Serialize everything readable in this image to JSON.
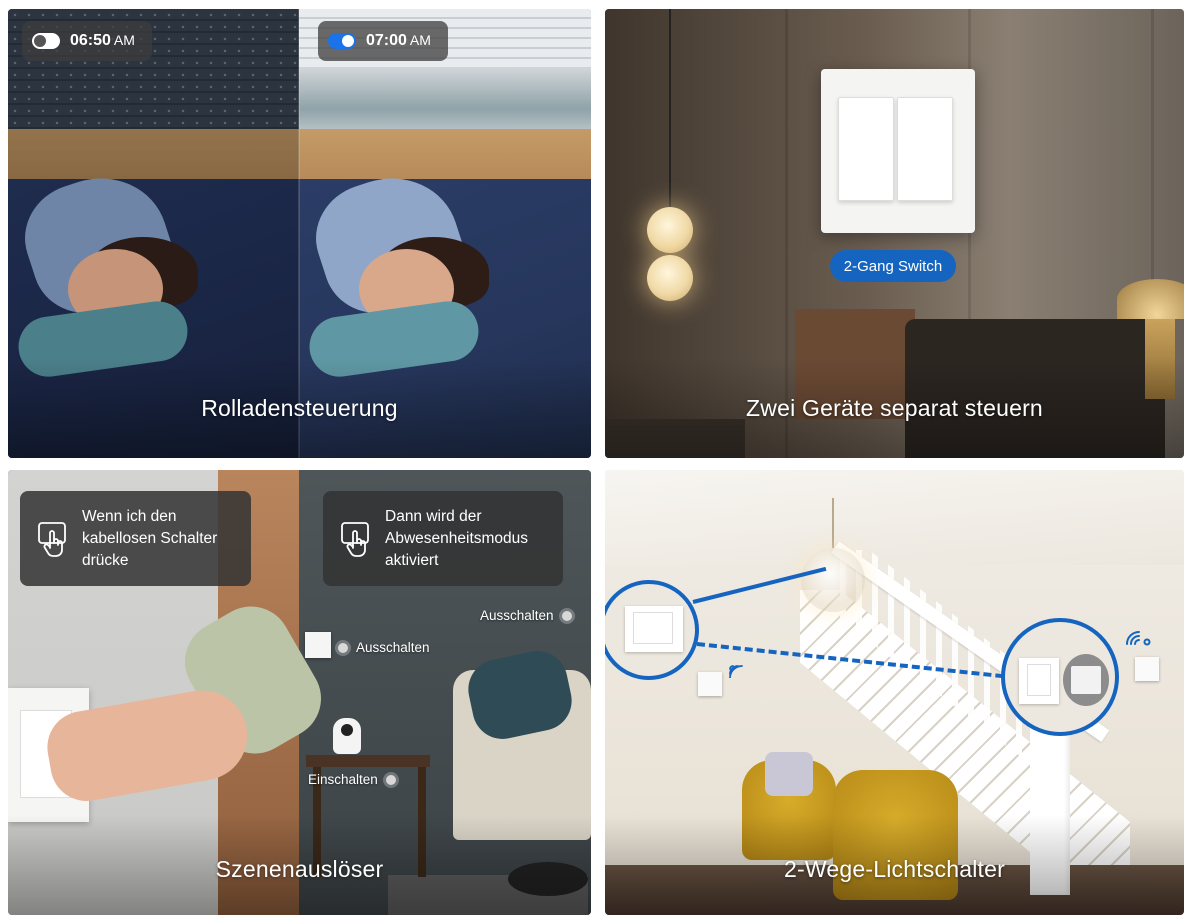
{
  "panels": {
    "roller_shutter": {
      "caption": "Rolladensteuerung",
      "schedule_off": {
        "time": "06:50",
        "ampm": "AM",
        "enabled": false
      },
      "schedule_on": {
        "time": "07:00",
        "ampm": "AM",
        "enabled": true
      }
    },
    "two_devices": {
      "caption": "Zwei Geräte separat steuern",
      "badge": "2-Gang Switch"
    },
    "scene_trigger": {
      "caption": "Szenenauslöser",
      "if_box": {
        "line1": "Wenn ich den",
        "line2": "kabellosen Schalter",
        "line3": "drücke"
      },
      "then_box": {
        "line1": "Dann wird der",
        "line2": "Abwesenheitsmodus",
        "line3": "aktiviert"
      },
      "tags": {
        "off_1": "Ausschalten",
        "off_2": "Ausschalten",
        "on": "Einschalten"
      }
    },
    "two_way": {
      "caption": "2-Wege-Lichtschalter"
    }
  },
  "icons": {
    "toggle_off": "toggle-off-icon",
    "toggle_on": "toggle-on-icon",
    "press": "hand-press-icon",
    "wireless": "wifi-signal-icon"
  },
  "colors": {
    "accent": "#1565c0",
    "toggle_on": "#1a73e8",
    "chip_bg": "rgba(60,60,60,0.75)",
    "caption_text": "#ffffff"
  }
}
